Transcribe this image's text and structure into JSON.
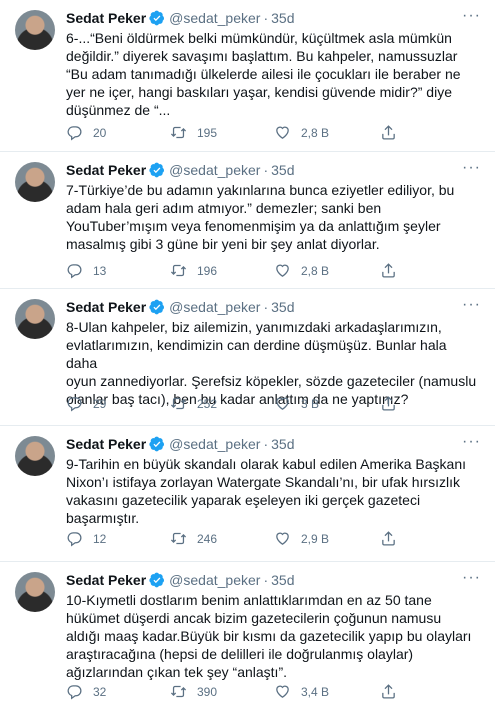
{
  "tweets": [
    {
      "author": "Sedat Peker",
      "handle": "@sedat_peker",
      "separator": "·",
      "time": "35d",
      "text": "6-...“Beni öldürmek belki mümkündür, küçültmek asla mümkün\ndeğildir.” diyerek savaşımı başlattım. Bu kahpeler, namussuzlar\n“Bu adam tanımadığı ülkelerde ailesi ile çocukları ile beraber ne\nyer ne içer, hangi baskıları yaşar, kendisi güvende midir?” diye\ndüşünmez de “...",
      "replies": "20",
      "retweets": "195",
      "likes": "2,8 B"
    },
    {
      "author": "Sedat Peker",
      "handle": "@sedat_peker",
      "separator": "·",
      "time": "35d",
      "text": "7-Türkiye’de bu adamın yakınlarına bunca eziyetler ediliyor, bu\nadam hala geri adım atmıyor.” demezler; sanki ben\nYouTuber’mışım veya fenomenmişim ya da anlattığım şeyler\nmasalmış gibi 3 güne bir yeni bir şey anlat diyorlar.",
      "replies": "13",
      "retweets": "196",
      "likes": "2,8 B"
    },
    {
      "author": "Sedat Peker",
      "handle": "@sedat_peker",
      "separator": "·",
      "time": "35d",
      "text": "8-Ulan kahpeler, biz ailemizin, yanımızdaki arkadaşlarımızın,\nevlatlarımızın, kendimizin can derdine düşmüşüz. Bunlar hala daha\noyun zannediyorlar. Şerefsiz köpekler, sözde gazeteciler (namuslu\nolanlar baş tacı), ben bu kadar anlattım da ne yaptınız?",
      "replies": "29",
      "retweets": "252",
      "likes": "3 B"
    },
    {
      "author": "Sedat Peker",
      "handle": "@sedat_peker",
      "separator": "·",
      "time": "35d",
      "text": "9-Tarihin en büyük skandalı olarak kabul edilen Amerika Başkanı\nNixon’ı istifaya zorlayan Watergate Skandalı’nı, bir ufak hırsızlık\nvakasını gazetecilik yaparak eşeleyen iki gerçek gazeteci\nbaşarmıştır.",
      "replies": "12",
      "retweets": "246",
      "likes": "2,9 B"
    },
    {
      "author": "Sedat Peker",
      "handle": "@sedat_peker",
      "separator": "·",
      "time": "35d",
      "text": "10-Kıymetli dostlarım benim anlattıklarımdan en az 50 tane\nhükümet düşerdi ancak bizim gazetecilerin çoğunun namusu\naldığı maaş kadar.Büyük bir kısmı da gazetecilik yapıp bu olayları\naraştıracağına (hepsi de delilleri ile doğrulanmış olaylar)\nağızlarından çıkan tek şey “anlaştı”.",
      "replies": "32",
      "retweets": "390",
      "likes": "3,4 B"
    }
  ],
  "icons": {
    "more": "more-horizontal-icon",
    "verified": "verified-badge-icon",
    "reply": "reply-icon",
    "retweet": "retweet-icon",
    "like": "like-icon",
    "share": "share-icon"
  },
  "colors": {
    "verified": "#1da1f2",
    "muted": "#5b7083",
    "divider": "#e6ecf0"
  }
}
